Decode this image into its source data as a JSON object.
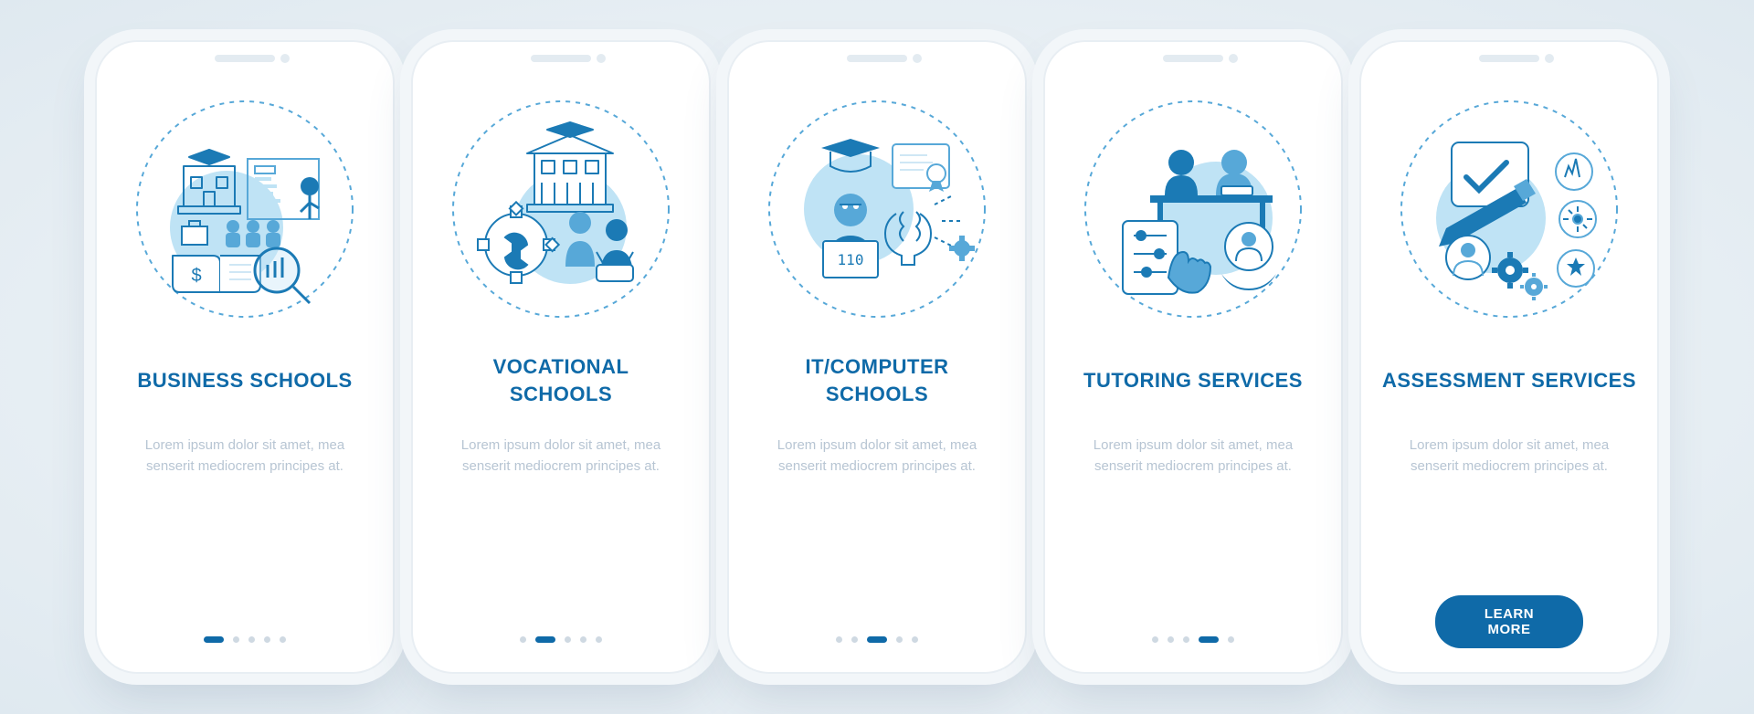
{
  "colors": {
    "primary": "#0f6aa8",
    "primaryLight": "#57a8d8",
    "muted": "#cfd9e2"
  },
  "screens": [
    {
      "title": "BUSINESS SCHOOLS",
      "description": "Lorem ipsum dolor sit amet, mea senserit mediocrem principes at.",
      "activeDot": 0,
      "type": "dots"
    },
    {
      "title": "VOCATIONAL\nSCHOOLS",
      "description": "Lorem ipsum dolor sit amet, mea senserit mediocrem principes at.",
      "activeDot": 1,
      "type": "dots"
    },
    {
      "title": "IT/COMPUTER\nSCHOOLS",
      "description": "Lorem ipsum dolor sit amet, mea senserit mediocrem principes at.",
      "activeDot": 2,
      "type": "dots"
    },
    {
      "title": "TUTORING SERVICES",
      "description": "Lorem ipsum dolor sit amet, mea senserit mediocrem principes at.",
      "activeDot": 3,
      "type": "dots"
    },
    {
      "title": "ASSESSMENT SERVICES",
      "description": "Lorem ipsum dolor sit amet, mea senserit mediocrem principes at.",
      "activeDot": 4,
      "type": "cta",
      "cta": "LEARN MORE"
    }
  ],
  "dotCount": 5
}
